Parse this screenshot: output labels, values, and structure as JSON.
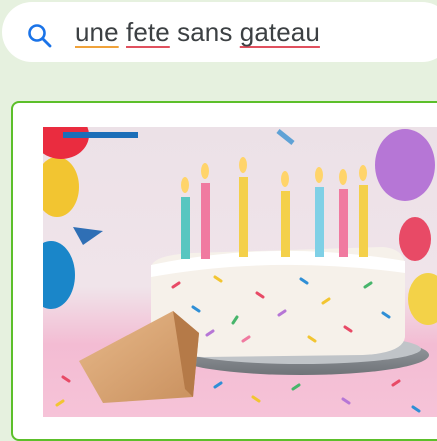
{
  "search": {
    "query_words": [
      "une",
      "fete",
      "sans",
      "gateau"
    ],
    "spellcheck_flagged": [
      "une",
      "fete",
      "gateau"
    ]
  },
  "result": {
    "selected": true,
    "image_subject": "cake-photo"
  },
  "colors": {
    "page_background": "#e6f1df",
    "search_icon": "#1a73e8",
    "selected_border": "#5cbf2a",
    "underline_orange": "#f0a23a",
    "underline_red": "#e0505e"
  }
}
